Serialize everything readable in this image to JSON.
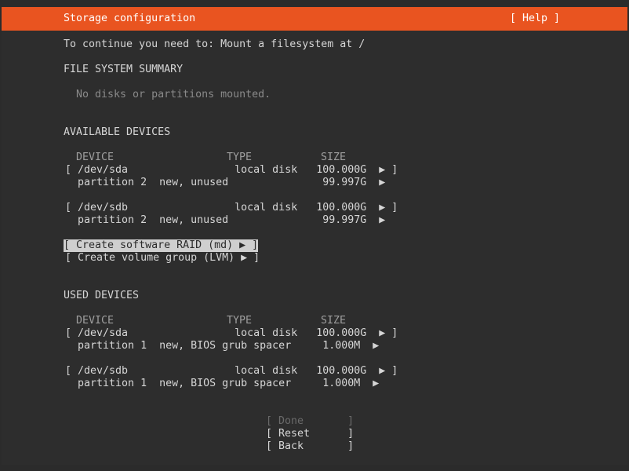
{
  "header": {
    "title": "Storage configuration",
    "help": "[ Help ]"
  },
  "prompt": "To continue you need to: Mount a filesystem at /",
  "fs_summary": {
    "heading": "FILE SYSTEM SUMMARY",
    "empty": "No disks or partitions mounted."
  },
  "available": {
    "heading": "AVAILABLE DEVICES",
    "col_device": "DEVICE",
    "col_type": "TYPE",
    "col_size": "SIZE",
    "rows": [
      {
        "text": "[ /dev/sda                 local disk   100.000G  ▶ ]"
      },
      {
        "text": "  partition 2  new, unused               99.997G  ▶"
      },
      {
        "text": "[ /dev/sdb                 local disk   100.000G  ▶ ]"
      },
      {
        "text": "  partition 2  new, unused               99.997G  ▶"
      }
    ],
    "create_raid": "[ Create software RAID (md) ▶ ]",
    "create_lvm": "[ Create volume group (LVM) ▶ ]"
  },
  "used": {
    "heading": "USED DEVICES",
    "col_device": "DEVICE",
    "col_type": "TYPE",
    "col_size": "SIZE",
    "rows": [
      {
        "text": "[ /dev/sda                 local disk   100.000G  ▶ ]"
      },
      {
        "text": "  partition 1  new, BIOS grub spacer     1.000M  ▶"
      },
      {
        "text": "[ /dev/sdb                 local disk   100.000G  ▶ ]"
      },
      {
        "text": "  partition 1  new, BIOS grub spacer     1.000M  ▶"
      }
    ]
  },
  "buttons": {
    "done": "[ Done       ]",
    "reset": "[ Reset      ]",
    "back": "[ Back       ]"
  },
  "colors": {
    "accent": "#e95420",
    "background": "#2d2d2d",
    "text": "#d6d6d6"
  }
}
